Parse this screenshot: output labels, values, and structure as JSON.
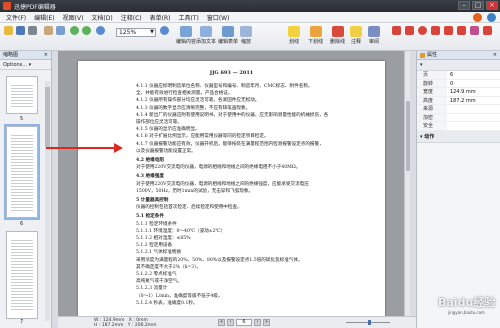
{
  "window": {
    "title": "迅捷PDF编辑器"
  },
  "menu": [
    "文件(F)",
    "编辑(E)",
    "视图(V)",
    "文档(D)",
    "注释(C)",
    "表单(R)",
    "工具(T)",
    "窗口(W)"
  ],
  "toolbar": {
    "zoom_value": "125%",
    "buttons": [
      "编辑内容",
      "添加文本",
      "编辑表单",
      "缩放",
      "划线",
      "下划线",
      "删除线",
      "注释",
      "审阅"
    ]
  },
  "left_panel": {
    "title": "缩略图",
    "options_label": "Options...",
    "page_labels": [
      "5",
      "6",
      "7"
    ]
  },
  "document": {
    "header": "JJG 693 — 2011",
    "lines": [
      "4.1.1  仪器应标明制造单位名称、仪器型号和编号、制造年月、CMC标志、附件名称。",
      "全，并能有效进行检查相关测量。产品合格证。",
      "4.1.2  仪器所有操作部分均应灵活可靠，各紧固件应无松动。",
      "4.1.3  仪器的数字显示应清晰完整，不应有缺笔画现象。",
      "4.1.4  新出厂的仪器应附有使用说明书，对于使用中的仪器，应无影响测量性能的机械损伤，各",
      "操作部位应灵活可靠。",
      "4.1.5  仪器的显示应准确明显。",
      "4.1.6  对于扩展比例显示，应能用常用仪器等同的检定项目检定。",
      "4.1.7  仪器报警功能应有效，仪器开机后，能够按装在满量程范围内检测报警设定点的报警，",
      "以及仪器报警功能设置正常。",
      "4.2  绝缘电阻",
      "   对于使用220V交流电的仪器，电源的相线和地线之间的绝缘电阻不小于40MΩ。",
      "4.3  绝缘强度",
      "   对于使用220V交流电的仪器，电源的相线和地线之间的绝缘强度，应能承受交流电压",
      "1500V，50Hz，历时1min的试验，无击穿和飞弧现象。",
      "5  计量器具控制",
      "   仪器的控制包括首次检定、后续检定和使用中检查。",
      "5.1  检定条件",
      "5.1.1  检定环境条件",
      "5.1.1.1  环境温度：0～40℃（波动±2℃）",
      "5.1.1.2  相对湿度：≤85%",
      "5.1.2  检定用设备",
      "5.1.2.1  气体标准物质",
      "   采用浓度为满量程的20%、50%、80%以及报警设定点1.5倍的硫化氢标准气体。",
      "其不确定度不大于2%（k=3）。",
      "5.1.2.2  零点标准气",
      "   高纯氮气或干净空气。",
      "5.1.2.3  流量计",
      "   （0～1）L/min，准确度等级不低于4级。",
      "5.1.2.4  秒表，准确度0.1秒。"
    ]
  },
  "right_panel": {
    "title": "属性",
    "sections": [
      {
        "name": "",
        "rows": [
          {
            "key": "页",
            "value": "6"
          },
          {
            "key": "旋转",
            "value": "0"
          },
          {
            "key": "宽度",
            "value": "124.9 mm"
          },
          {
            "key": "高度",
            "value": "187.2 mm"
          },
          {
            "key": "来源",
            "value": ""
          },
          {
            "key": "加密",
            "value": ""
          },
          {
            "key": "安全",
            "value": ""
          }
        ]
      },
      {
        "name": "动作",
        "rows": []
      }
    ]
  },
  "status": {
    "width_label": "W : 124.9mm",
    "height_label": "H : 187.2mm",
    "x_label": "X : 0mm",
    "y_label": "Y : 206.2mm",
    "page_box": "6"
  },
  "watermark": {
    "text": "Baidu经验",
    "sub": "jingyan.baidu.com"
  },
  "colors": {
    "arrow": "#e0281e",
    "accent": "#3a78c8"
  }
}
